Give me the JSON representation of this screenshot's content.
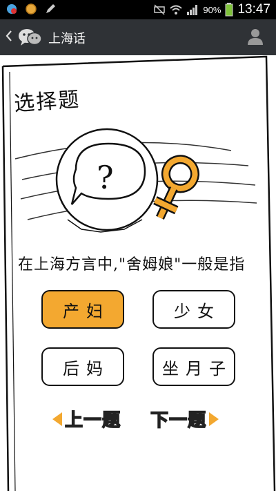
{
  "status_bar": {
    "battery_percent": "90%",
    "time": "13:47"
  },
  "app_bar": {
    "back_icon": "chevron-left-icon",
    "logo_icon": "chat-bubbles-icon",
    "title": "上海话",
    "profile_icon": "person-icon"
  },
  "quiz": {
    "heading": "选择题",
    "illustration": "question-bubble-with-female-symbol",
    "question": "在上海方言中,\"舍姆娘\"一般是指",
    "options": [
      {
        "label": "产妇",
        "selected": true
      },
      {
        "label": "少女",
        "selected": false
      },
      {
        "label": "后妈",
        "selected": false
      },
      {
        "label": "坐月子",
        "selected": false
      }
    ],
    "prev_label": "上一题",
    "next_label": "下一题",
    "accent_color": "#f3a830"
  }
}
